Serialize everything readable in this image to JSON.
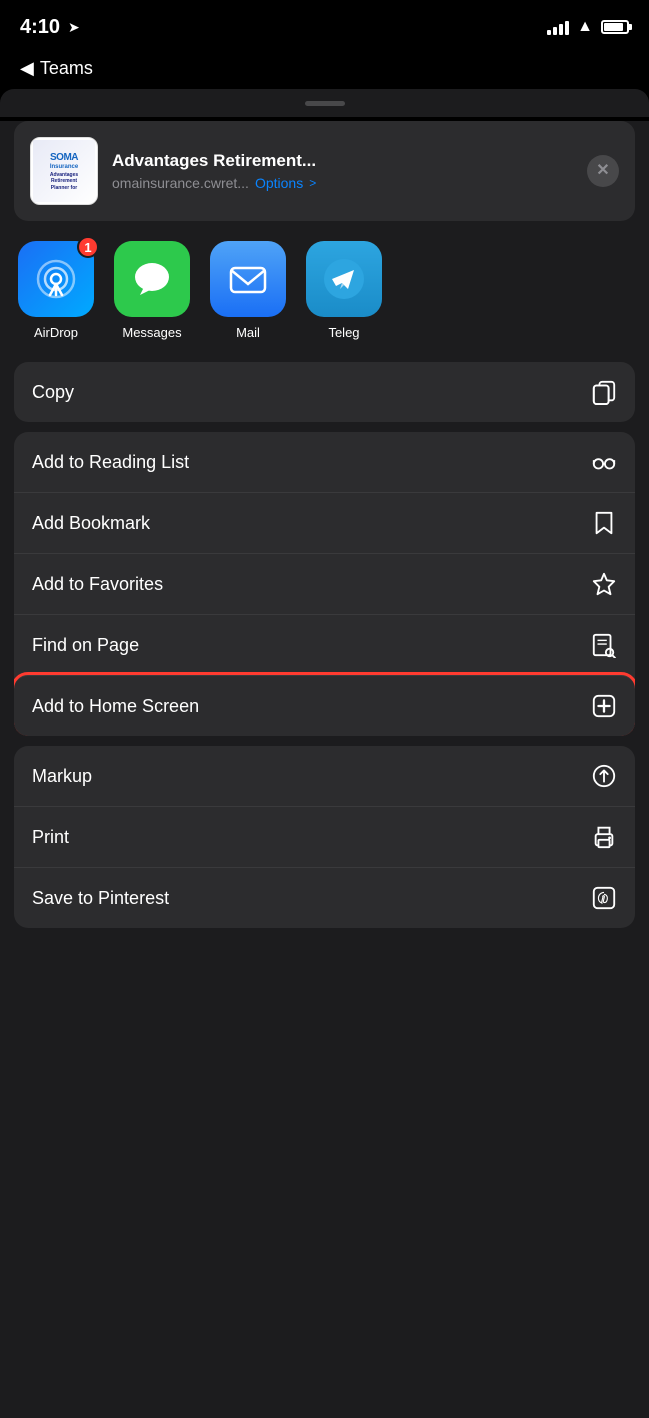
{
  "statusBar": {
    "time": "4:10",
    "backLabel": "Teams"
  },
  "preview": {
    "title": "Advantages Retirement...",
    "url": "omainsurance.cwret...",
    "options": "Options",
    "optionsChevron": ">"
  },
  "apps": [
    {
      "id": "airdrop",
      "label": "AirDrop",
      "badge": "1",
      "type": "airdrop"
    },
    {
      "id": "messages",
      "label": "Messages",
      "badge": null,
      "type": "messages"
    },
    {
      "id": "mail",
      "label": "Mail",
      "badge": null,
      "type": "mail"
    },
    {
      "id": "telegram",
      "label": "Teleg",
      "badge": null,
      "type": "telegram"
    }
  ],
  "actions": {
    "group1": [
      {
        "id": "copy",
        "label": "Copy",
        "icon": "copy"
      }
    ],
    "group2": [
      {
        "id": "add-reading-list",
        "label": "Add to Reading List",
        "icon": "glasses"
      },
      {
        "id": "add-bookmark",
        "label": "Add Bookmark",
        "icon": "bookmark"
      },
      {
        "id": "add-favorites",
        "label": "Add to Favorites",
        "icon": "star"
      },
      {
        "id": "find-on-page",
        "label": "Find on Page",
        "icon": "find"
      },
      {
        "id": "add-home-screen",
        "label": "Add to Home Screen",
        "icon": "add-square",
        "highlighted": true
      }
    ],
    "group3": [
      {
        "id": "markup",
        "label": "Markup",
        "icon": "markup"
      },
      {
        "id": "print",
        "label": "Print",
        "icon": "print"
      },
      {
        "id": "save-pinterest",
        "label": "Save to Pinterest",
        "icon": "pinterest"
      }
    ]
  }
}
